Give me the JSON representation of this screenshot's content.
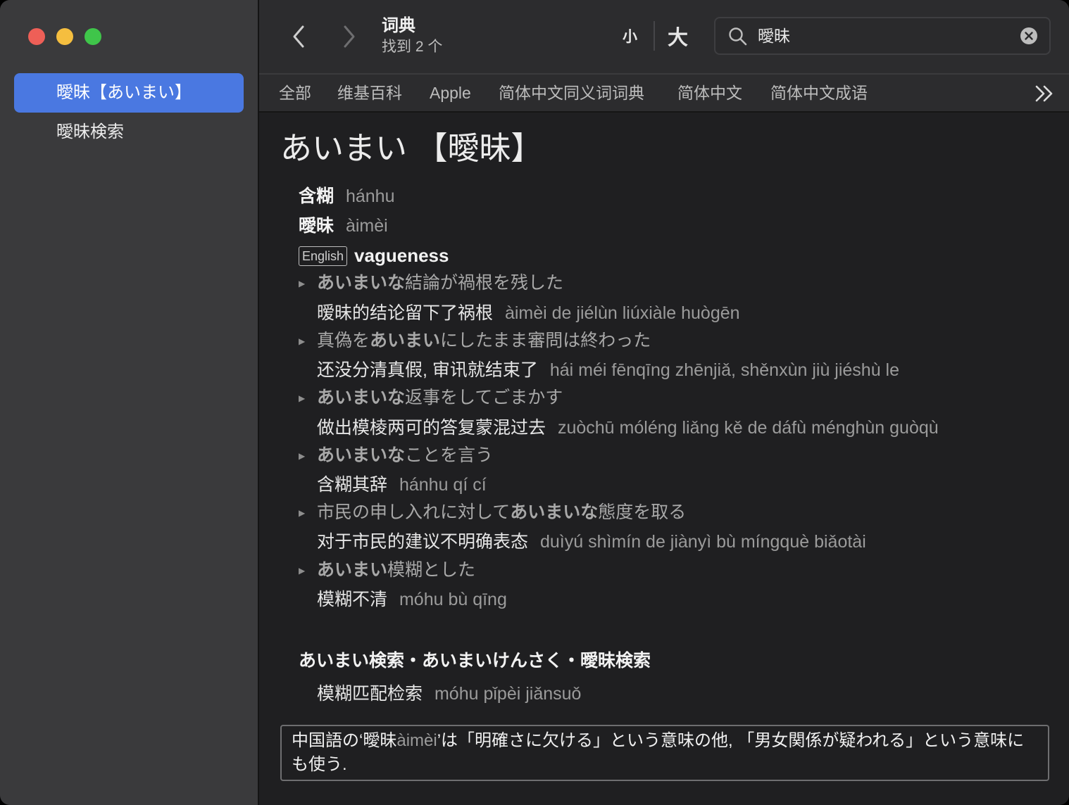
{
  "sidebar": {
    "items": [
      {
        "label": "曖昧【あいまい】",
        "selected": true
      },
      {
        "label": "曖昧検索",
        "selected": false
      }
    ]
  },
  "toolbar": {
    "title": "词典",
    "subtitle": "找到 2 个",
    "font_small": "小",
    "font_large": "大",
    "search_query": "曖昧"
  },
  "tabs": [
    "全部",
    "维基百科",
    "Apple",
    "简体中文同义词词典",
    "简体中文",
    "简体中文成语"
  ],
  "entry": {
    "headword": "あいまい 【曖昧】",
    "translations": [
      {
        "word": "含糊",
        "pinyin": "hánhu"
      },
      {
        "word": "曖昧",
        "pinyin": "àimèi"
      }
    ],
    "english_badge": "English",
    "english": "vagueness",
    "examples": [
      {
        "ja_plain_pre": "",
        "ja_bold": "あいまいな",
        "ja_plain": "結論が禍根を残した",
        "zh": "暧昧的结论留下了祸根",
        "pinyin": "àimèi de jiélùn liúxiàle huògēn"
      },
      {
        "ja_plain_pre": "真偽を",
        "ja_bold": "あいまい",
        "ja_plain": "にしたまま審問は終わった",
        "zh": "还没分清真假, 审讯就结束了",
        "pinyin": "hái méi fēnqīng zhēnjiǎ, shěnxùn jiù jiéshù le"
      },
      {
        "ja_plain_pre": "",
        "ja_bold": "あいまいな",
        "ja_plain": "返事をしてごまかす",
        "zh": "做出模棱两可的答复蒙混过去",
        "pinyin": "zuòchū móléng liǎng kě de dáfù ménghùn guòqù"
      },
      {
        "ja_plain_pre": "",
        "ja_bold": "あいまいな",
        "ja_plain": "ことを言う",
        "zh": "含糊其辞",
        "pinyin": "hánhu qí cí"
      },
      {
        "ja_plain_pre": "市民の申し入れに対して",
        "ja_bold": "あいまいな",
        "ja_plain": "態度を取る",
        "zh": "对于市民的建议不明确表态",
        "pinyin": "duìyú shìmín de jiànyì bù míngquè biǎotài"
      },
      {
        "ja_plain_pre": "",
        "ja_bold": "あいまい",
        "ja_plain": "模糊とした",
        "zh": "模糊不清",
        "pinyin": "móhu bù qīng"
      }
    ],
    "sub_heading": "あいまい検索・あいまいけんさく・曖昧検索",
    "sub_translation": {
      "word": "模糊匹配检索",
      "pinyin": "móhu pǐpèi jiǎnsuǒ"
    },
    "note": {
      "pre": "中国語の‘曖昧",
      "pinyin": "àimèi",
      "post": "’は「明確さに欠ける」という意味の他, 「男女関係が疑われる」という意味にも使う."
    }
  },
  "colors": {
    "sidebar_bg": "#3a3a3c",
    "selection": "#4a78e1",
    "content_bg": "#1f1f21",
    "toolbar_bg": "#2c2c2e",
    "traffic_red": "#ee5f57",
    "traffic_yellow": "#f5be3f",
    "traffic_green": "#3fc54a"
  },
  "icons": [
    "back-chevron-icon",
    "forward-chevron-icon",
    "search-icon",
    "clear-icon",
    "more-tabs-icon"
  ]
}
